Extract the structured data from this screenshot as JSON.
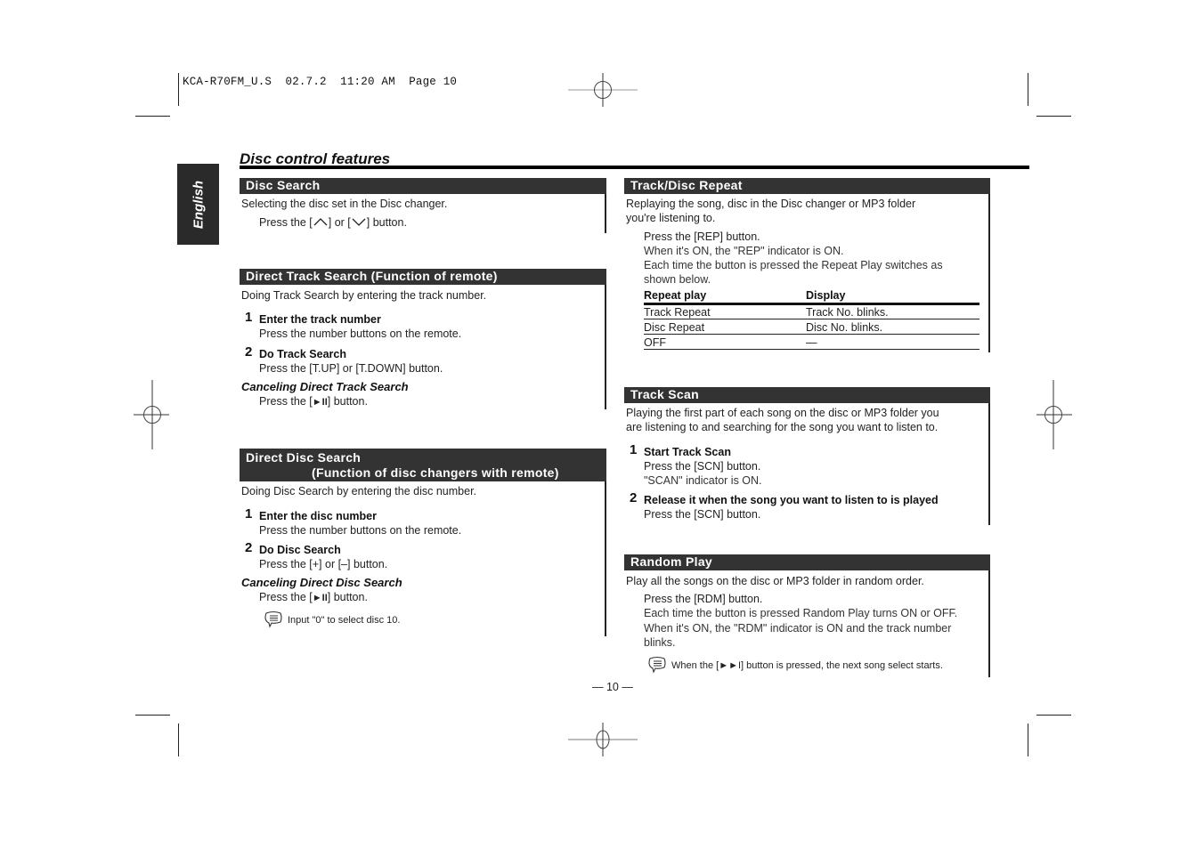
{
  "slug": {
    "file": "KCA-R70FM_U.S",
    "date": "02.7.2",
    "time": "11:20 AM",
    "page_label": "Page 10"
  },
  "language_tab": "English",
  "page_title": "Disc control features",
  "page_number": "— 10 —",
  "sections": {
    "disc_search": {
      "title": "Disc Search",
      "intro": "Selecting the disc set in the Disc changer.",
      "instruction_prefix": "Press the [",
      "instruction_mid": "] or [",
      "instruction_suffix": "] button.",
      "icons": [
        "chevron-up-icon",
        "chevron-down-icon"
      ]
    },
    "direct_track_search": {
      "title": "Direct Track Search (Function of remote)",
      "intro": "Doing Track Search by entering the track number.",
      "steps": [
        {
          "num": "1",
          "title": "Enter the track number",
          "text": "Press the number buttons on the remote."
        },
        {
          "num": "2",
          "title": "Do Track Search",
          "text": "Press the [T.UP] or [T.DOWN] button."
        }
      ],
      "cancel_title": "Canceling Direct Track Search",
      "cancel_text_prefix": "Press the [",
      "cancel_text_symbol": "►II",
      "cancel_text_suffix": "] button."
    },
    "direct_disc_search": {
      "title_line1": "Direct Disc Search",
      "title_line2": "(Function of disc changers with remote)",
      "intro": "Doing Disc Search by entering the disc number.",
      "steps": [
        {
          "num": "1",
          "title": "Enter the disc number",
          "text": "Press the number buttons on the remote."
        },
        {
          "num": "2",
          "title": "Do Disc Search",
          "text": "Press the [+] or [–] button."
        }
      ],
      "cancel_title": "Canceling Direct Disc Search",
      "cancel_text_prefix": "Press the [",
      "cancel_text_symbol": "►II",
      "cancel_text_suffix": "] button.",
      "note": "Input \"0\" to select disc 10."
    },
    "track_disc_repeat": {
      "title": "Track/Disc Repeat",
      "intro_line1": "Replaying the song, disc in the Disc changer or MP3 folder",
      "intro_line2": "you're listening to.",
      "instruction": "Press the [REP] button.",
      "desc_line1": "When it's ON, the \"REP\" indicator is ON.",
      "desc_line2": "Each time the button is pressed the Repeat Play switches as",
      "desc_line3": "shown below.",
      "table": {
        "headers": [
          "Repeat play",
          "Display"
        ],
        "rows": [
          [
            "Track Repeat",
            "Track No. blinks."
          ],
          [
            "Disc Repeat",
            "Disc No. blinks."
          ],
          [
            "OFF",
            "—"
          ]
        ]
      }
    },
    "track_scan": {
      "title": "Track Scan",
      "intro_line1": "Playing the first part of each song on the disc or MP3 folder you",
      "intro_line2": "are listening to and searching for the song you want to listen to.",
      "steps": [
        {
          "num": "1",
          "title": "Start Track Scan",
          "text": "Press the [SCN] button.",
          "subtext": "\"SCAN\" indicator is ON."
        },
        {
          "num": "2",
          "title": "Release it when the song you want to listen to is played",
          "text": "Press the [SCN] button."
        }
      ]
    },
    "random_play": {
      "title": "Random Play",
      "intro": "Play all the songs on the disc or MP3 folder in random order.",
      "instruction": "Press the [RDM] button.",
      "desc_line1": "Each time the button is pressed Random Play turns ON or OFF.",
      "desc_line2": "When it's ON, the \"RDM\" indicator is ON and the track number",
      "desc_line3": "blinks.",
      "note": "When the [►►I] button is pressed, the next song select starts."
    }
  }
}
